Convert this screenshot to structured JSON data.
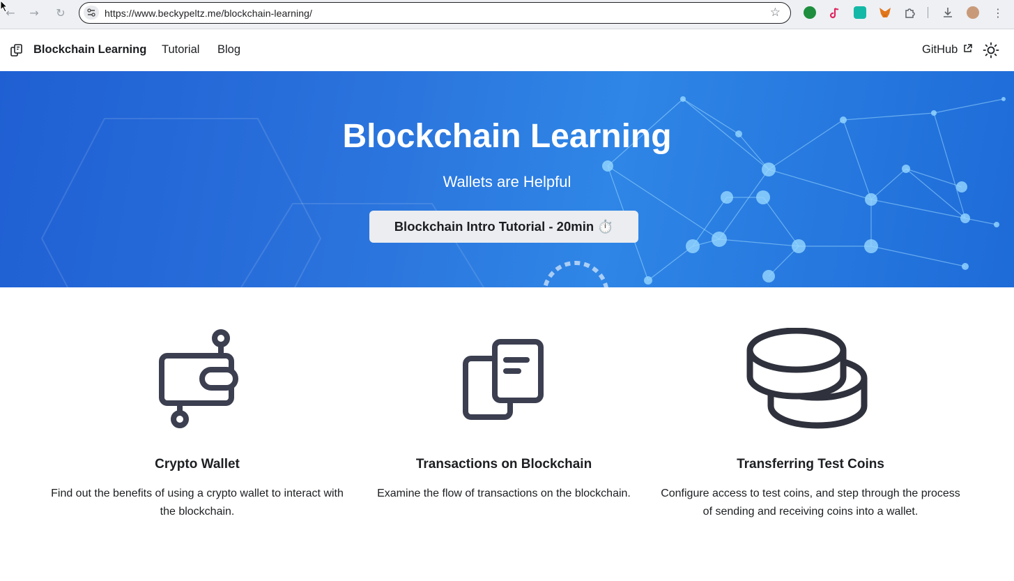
{
  "browser": {
    "url": "https://www.beckypeltz.me/blockchain-learning/",
    "back_icon": "←",
    "forward_icon": "→",
    "reload_icon": "↻",
    "star_icon": "☆",
    "menu_icon": "⋮"
  },
  "navbar": {
    "brand": "Blockchain Learning",
    "links": [
      "Tutorial",
      "Blog"
    ],
    "github": "GitHub"
  },
  "hero": {
    "title": "Blockchain Learning",
    "subtitle": "Wallets are Helpful",
    "button": "Blockchain Intro Tutorial - 20min ⏱️"
  },
  "features": [
    {
      "icon": "wallet-icon",
      "title": "Crypto Wallet",
      "description": "Find out the benefits of using a crypto wallet to interact with the blockchain."
    },
    {
      "icon": "documents-icon",
      "title": "Transactions on Blockchain",
      "description": "Examine the flow of transactions on the blockchain."
    },
    {
      "icon": "coins-icon",
      "title": "Transferring Test Coins",
      "description": "Configure access to test coins, and step through the process of sending and receiving coins into a wallet."
    }
  ],
  "colors": {
    "hero_blue": "#2a72dc",
    "icon_stroke": "#3b3f50",
    "text": "#1c1e21"
  }
}
